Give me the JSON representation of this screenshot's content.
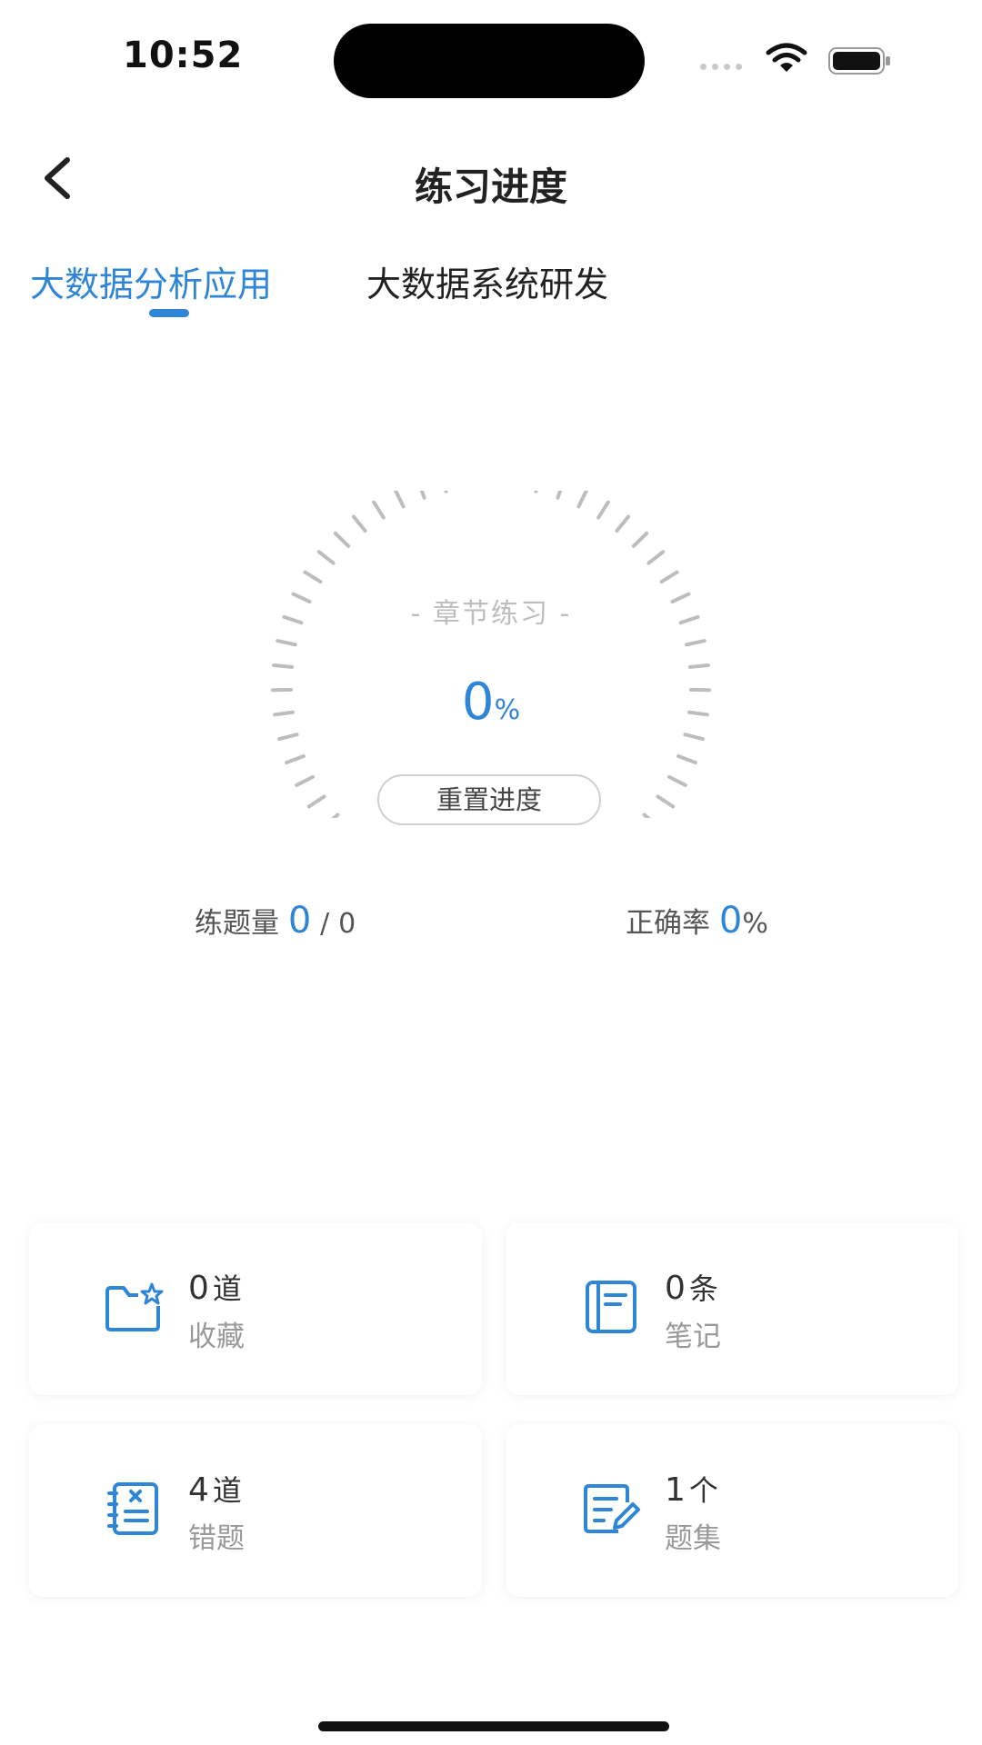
{
  "status_bar": {
    "time": "10:52"
  },
  "nav": {
    "title": "练习进度"
  },
  "tabs": [
    {
      "label": "大数据分析应用",
      "active": true
    },
    {
      "label": "大数据系统研发",
      "active": false
    }
  ],
  "gauge": {
    "caption": "- 章节练习 -",
    "value": "0",
    "unit": "%",
    "progress_fraction": 0,
    "reset_label": "重置进度"
  },
  "stats": {
    "count_label": "练题量",
    "count_done": "0",
    "count_sep": "/",
    "count_total": "0",
    "accuracy_label": "正确率",
    "accuracy_value": "0",
    "accuracy_unit": "%"
  },
  "cards": [
    {
      "value": "0",
      "unit": "道",
      "label": "收藏",
      "icon": "folder-star-icon"
    },
    {
      "value": "0",
      "unit": "条",
      "label": "笔记",
      "icon": "notebook-icon"
    },
    {
      "value": "4",
      "unit": "道",
      "label": "错题",
      "icon": "wrong-notebook-icon"
    },
    {
      "value": "1",
      "unit": "个",
      "label": "题集",
      "icon": "edit-document-icon"
    }
  ],
  "colors": {
    "accent": "#2f86d6",
    "tick": "#bdbdbd"
  }
}
